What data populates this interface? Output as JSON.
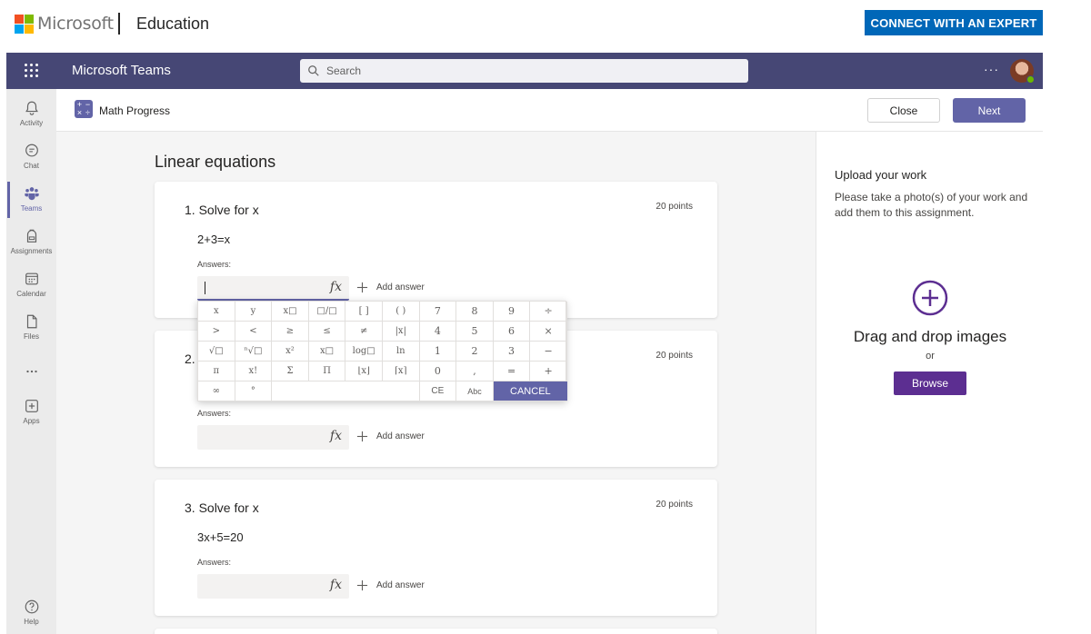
{
  "banner": {
    "brand": "Microsoft",
    "product": "Education",
    "cta_label": "CONNECT WITH AN EXPERT",
    "logo_colors": [
      "#f25022",
      "#7fba00",
      "#00a4ef",
      "#ffb900"
    ]
  },
  "teams": {
    "app_title": "Microsoft Teams",
    "search_placeholder": "Search",
    "more_label": "···",
    "accent": "#6264a7"
  },
  "rail": {
    "items": [
      {
        "label": "Activity",
        "icon": "bell-icon"
      },
      {
        "label": "Chat",
        "icon": "chat-icon"
      },
      {
        "label": "Teams",
        "icon": "teams-icon",
        "active": true
      },
      {
        "label": "Assignments",
        "icon": "backpack-icon"
      },
      {
        "label": "Calendar",
        "icon": "calendar-icon"
      },
      {
        "label": "Files",
        "icon": "file-icon"
      },
      {
        "label": "",
        "icon": "more-dots-icon"
      },
      {
        "label": "Apps",
        "icon": "apps-icon"
      },
      {
        "label": "Help",
        "icon": "help-icon"
      }
    ]
  },
  "header": {
    "title": "Math Progress",
    "close_label": "Close",
    "next_label": "Next"
  },
  "assignment": {
    "section_title": "Linear equations",
    "answers_label": "Answers:",
    "add_answer_label": "Add answer",
    "questions": [
      {
        "title": "1. Solve for x",
        "points": "20 points",
        "equation": "2+3=x"
      },
      {
        "title": "2.",
        "points": "20 points",
        "equation": ""
      },
      {
        "title": "3. Solve for x",
        "points": "20 points",
        "equation": "3x+5=20"
      }
    ]
  },
  "keypad": {
    "rows": [
      [
        "x",
        "y",
        "x□",
        "□/□",
        "[ ]",
        "( )",
        "7",
        "8",
        "9",
        "÷"
      ],
      [
        ">",
        "<",
        "≥",
        "≤",
        "≠",
        "|x|",
        "4",
        "5",
        "6",
        "×"
      ],
      [
        "√□",
        "ⁿ√□",
        "x²",
        "x□",
        "log□",
        "ln",
        "1",
        "2",
        "3",
        "−"
      ],
      [
        "π",
        "x!",
        "Σ",
        "Π",
        "⌊x⌋",
        "⌈x⌉",
        "0",
        ",",
        "=",
        "+"
      ]
    ],
    "last_row": [
      "∞",
      "°"
    ],
    "ce_label": "CE",
    "abc_label": "Abc",
    "cancel_label": "CANCEL"
  },
  "upload": {
    "title": "Upload your work",
    "description": "Please take a photo(s) of your work and add them to this assignment.",
    "drop_title": "Drag and drop images",
    "or_label": "or",
    "browse_label": "Browse"
  }
}
